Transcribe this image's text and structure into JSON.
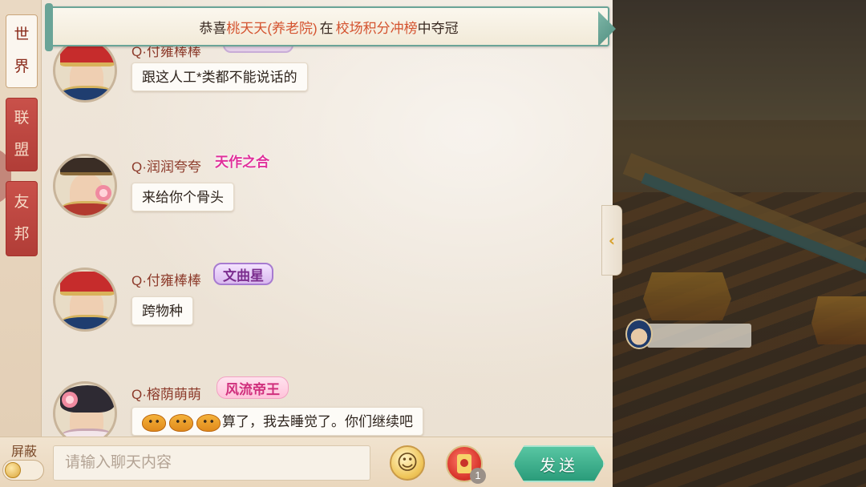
{
  "tabs": [
    {
      "label_chars": [
        "世",
        "界"
      ],
      "active": true
    },
    {
      "label_chars": [
        "联",
        "盟"
      ],
      "active": false
    },
    {
      "label_chars": [
        "友",
        "邦"
      ],
      "active": false
    }
  ],
  "banner": {
    "prefix": "恭喜",
    "player": "桃天天(养老院)",
    "middle": "在",
    "event": "校场积分冲榜",
    "suffix": "中夺冠"
  },
  "messages": [
    {
      "name": "Q·付雍棒棒",
      "title": "",
      "text": "跟这人工*类都不能说话的",
      "avatar": "official"
    },
    {
      "name": "Q·润润夸夸",
      "title": "天作之合",
      "text": "来给你个骨头",
      "avatar": "prince"
    },
    {
      "name": "Q·付雍棒棒",
      "title": "文曲星",
      "text": "跨物种",
      "avatar": "official"
    },
    {
      "name": "Q·榕荫萌萌",
      "title": "风流帝王",
      "text": "算了，我去睡觉了。你们继续吧",
      "avatar": "lady"
    }
  ],
  "bottom": {
    "block_label": "屏蔽",
    "input_placeholder": "请输入聊天内容",
    "redpacket_count": "1",
    "send_label": "发送"
  },
  "colors": {
    "accent_red": "#d4532f",
    "name_color": "#8c3a2a",
    "send_green": "#2a9c7a",
    "tab_red": "#b13d37"
  },
  "icons": [
    "emoji-face-icon",
    "red-packet-icon",
    "collapse-arrow-icon",
    "toggle-knob-icon"
  ]
}
